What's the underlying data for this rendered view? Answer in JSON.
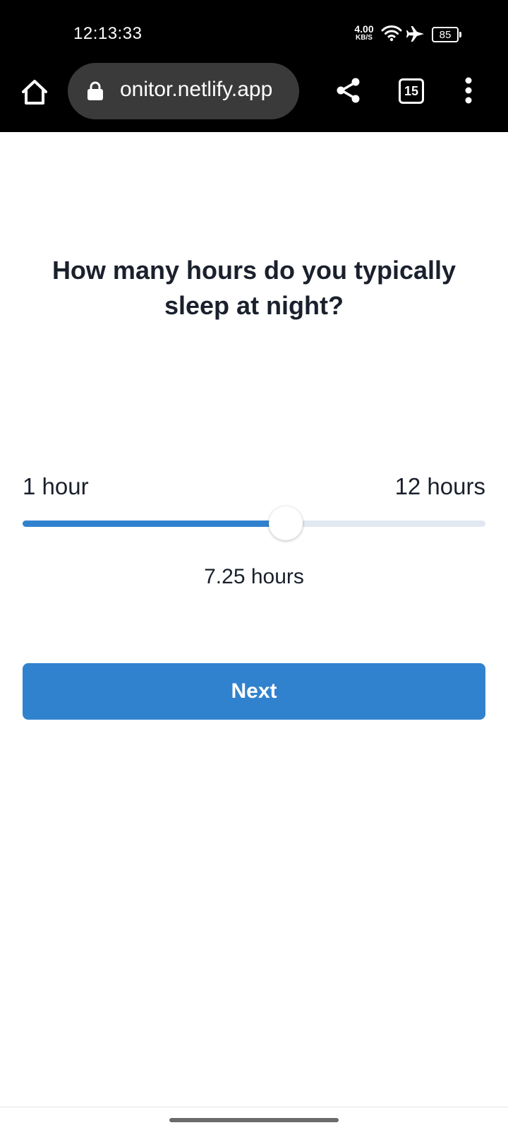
{
  "status_bar": {
    "time": "12:13:33",
    "net_speed": "4.00",
    "net_unit": "KB/S",
    "battery": "85",
    "icons": [
      "wifi-icon",
      "airplane-icon",
      "battery-icon"
    ]
  },
  "browser": {
    "url": "onitor.netlify.app",
    "tab_count": "15",
    "icons": [
      "home-icon",
      "lock-icon",
      "share-icon",
      "tabs-icon",
      "more-vert-icon"
    ]
  },
  "question": {
    "text": "How many hours do you typically sleep at night?"
  },
  "slider": {
    "min_label": "1 hour",
    "max_label": "12 hours",
    "min": 1,
    "max": 12,
    "value": 7.25,
    "value_label": "7.25 hours",
    "fill_color": "#3182ce",
    "track_color": "#e2e8f0"
  },
  "actions": {
    "next_label": "Next",
    "button_color": "#3182ce"
  }
}
